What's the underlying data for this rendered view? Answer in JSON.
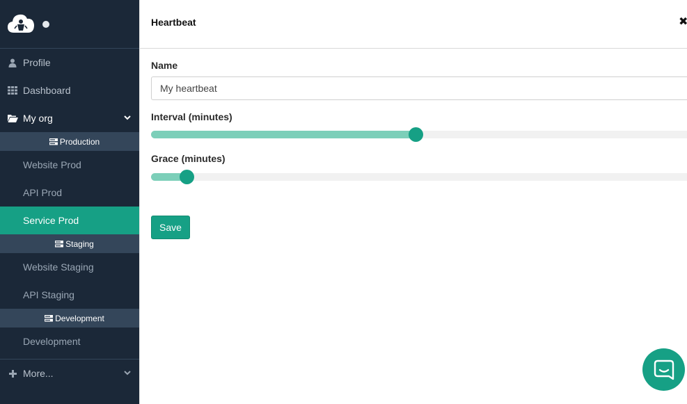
{
  "sidebar": {
    "logo_icon": "cloud-logo-icon",
    "status_dot": "online-dot-icon",
    "items": [
      {
        "label": "Profile",
        "icon": "user-icon"
      },
      {
        "label": "Dashboard",
        "icon": "grid-icon"
      },
      {
        "label": "My org",
        "icon": "folder-open-icon"
      }
    ],
    "groups": [
      {
        "header": "Production",
        "icon": "server-icon",
        "items": [
          "Website Prod",
          "API Prod",
          "Service Prod"
        ]
      },
      {
        "header": "Staging",
        "icon": "server-icon",
        "items": [
          "Website Staging",
          "API Staging"
        ]
      },
      {
        "header": "Development",
        "icon": "server-icon",
        "items": [
          "Development"
        ]
      }
    ],
    "active_item": "Service Prod",
    "more_label": "More..."
  },
  "panel": {
    "title": "Heartbeat",
    "close_icon": "close-icon",
    "name_label": "Name",
    "name_value": "My heartbeat",
    "interval_label": "Interval (minutes)",
    "interval_fraction": 0.487,
    "grace_label": "Grace (minutes)",
    "grace_fraction": 0.066,
    "save_label": "Save"
  },
  "chat": {
    "icon": "chat-bubble-icon"
  },
  "colors": {
    "sidebar_bg": "#1b2838",
    "accent": "#16a085",
    "slider_fill": "#7ccfb9",
    "group_header_bg": "#34465a"
  }
}
